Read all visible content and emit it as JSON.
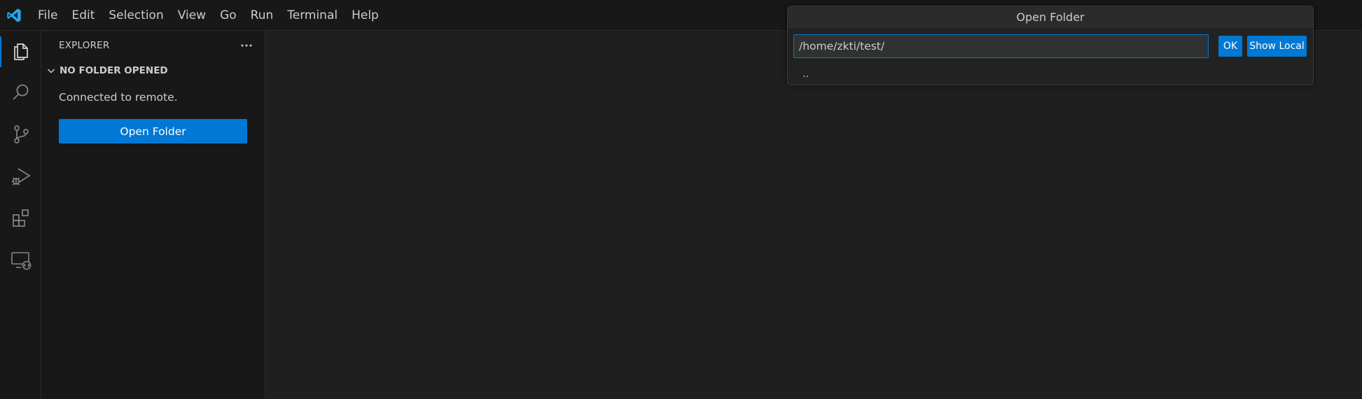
{
  "menu": {
    "items": [
      "File",
      "Edit",
      "Selection",
      "View",
      "Go",
      "Run",
      "Terminal",
      "Help"
    ]
  },
  "activity_bar": {
    "items": [
      {
        "name": "explorer",
        "icon": "files-icon",
        "active": true
      },
      {
        "name": "search",
        "icon": "search-icon",
        "active": false
      },
      {
        "name": "source-control",
        "icon": "source-control-icon",
        "active": false
      },
      {
        "name": "run-and-debug",
        "icon": "run-debug-icon",
        "active": false
      },
      {
        "name": "extensions",
        "icon": "extensions-icon",
        "active": false
      },
      {
        "name": "remote-explorer",
        "icon": "remote-explorer-icon",
        "active": false
      }
    ]
  },
  "sidebar": {
    "title": "EXPLORER",
    "section_title": "NO FOLDER OPENED",
    "message": "Connected to remote.",
    "open_folder_label": "Open Folder"
  },
  "quick_input": {
    "title": "Open Folder",
    "value": "/home/zkti/test/",
    "ok_label": "OK",
    "show_local_label": "Show Local",
    "list_items": [
      ".."
    ]
  },
  "colors": {
    "accent": "#0078d4",
    "background": "#1f1f1f",
    "sidebar": "#181818"
  }
}
